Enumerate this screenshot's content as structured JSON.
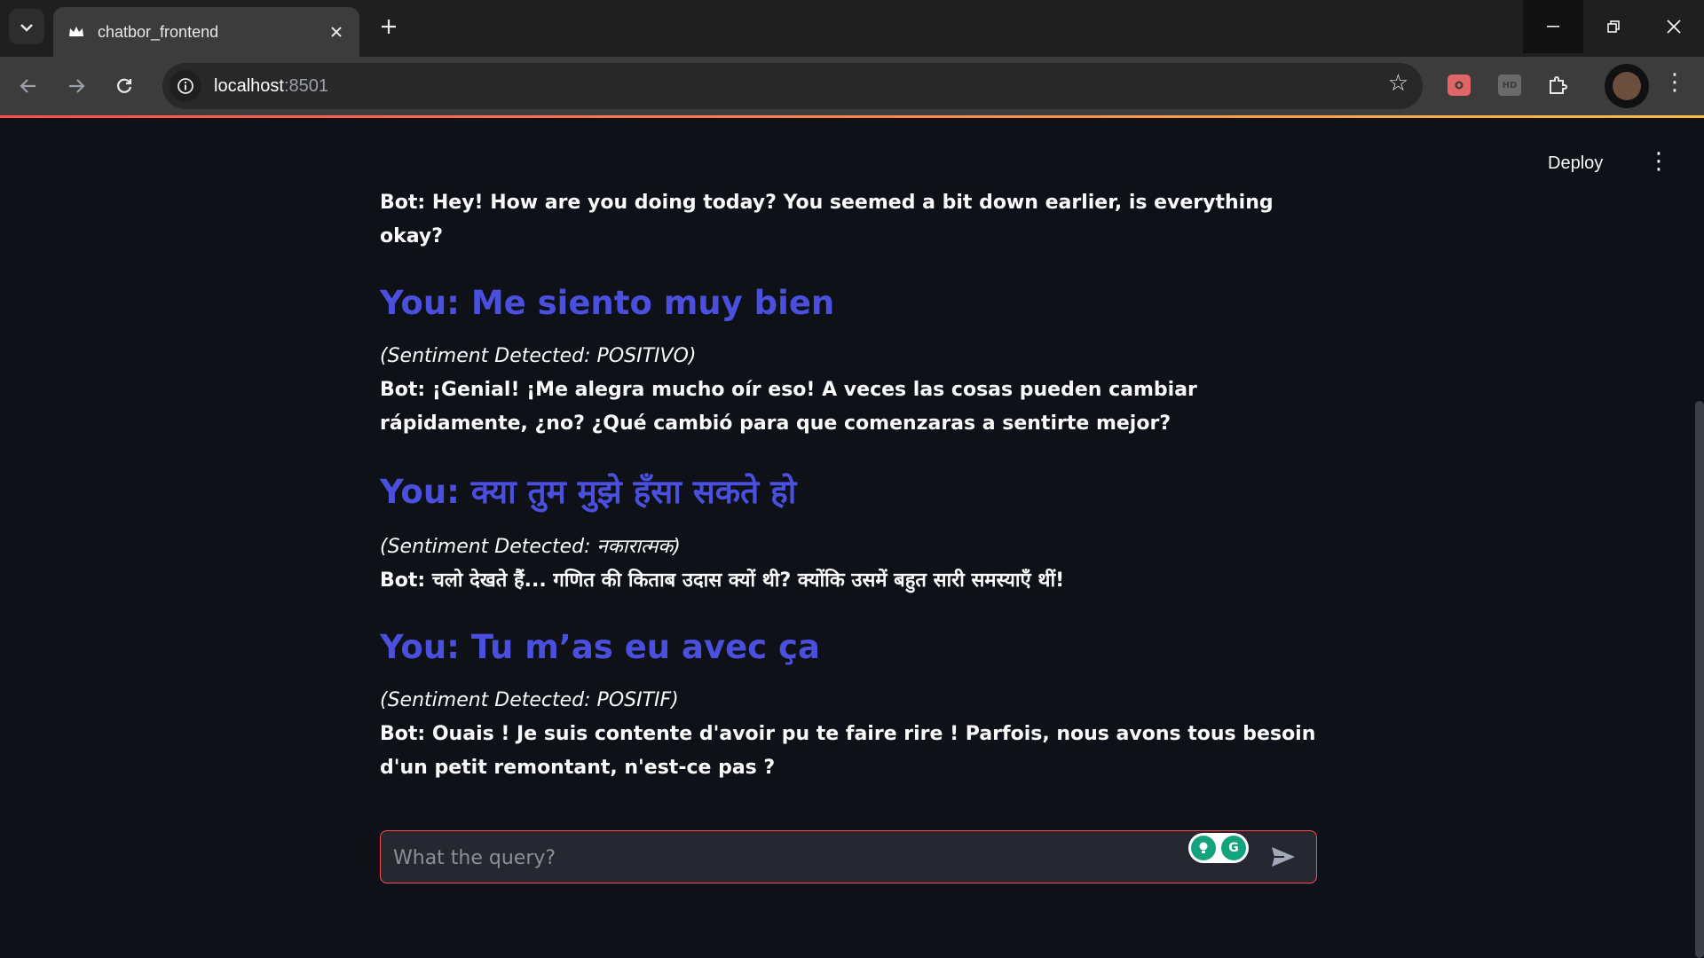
{
  "browser": {
    "tab_title": "chatbor_frontend",
    "url_host": "localhost",
    "url_port": ":8501"
  },
  "app": {
    "deploy_label": "Deploy"
  },
  "chat": {
    "bot_1": "Bot: Hey! How are you doing today? You seemed a bit down earlier, is everything okay?",
    "you_1": "You: Me siento muy bien",
    "sentiment_1": "(Sentiment Detected: POSITIVO)",
    "bot_2": "Bot: ¡Genial! ¡Me alegra mucho oír eso! A veces las cosas pueden cambiar rápidamente, ¿no? ¿Qué cambió para que comenzaras a sentirte mejor?",
    "you_2": "You: क्या तुम मुझे हँसा सकते हो",
    "sentiment_2": "(Sentiment Detected: नकारात्मक)",
    "bot_3": "Bot: चलो देखते हैं... गणित की किताब उदास क्यों थी? क्योंकि उसमें बहुत सारी समस्याएँ थीं!",
    "you_3": "You: Tu m’as eu avec ça",
    "sentiment_3": "(Sentiment Detected: POSITIF)",
    "bot_4": "Bot: Ouais ! Je suis contente d'avoir pu te faire rire ! Parfois, nous avons tous besoin d'un petit remontant, n'est-ce pas ?"
  },
  "input": {
    "placeholder": "What the query?"
  },
  "colors": {
    "background": "#0e1117",
    "user_text": "#4a4fde",
    "input_border": "#ff4b4b"
  }
}
